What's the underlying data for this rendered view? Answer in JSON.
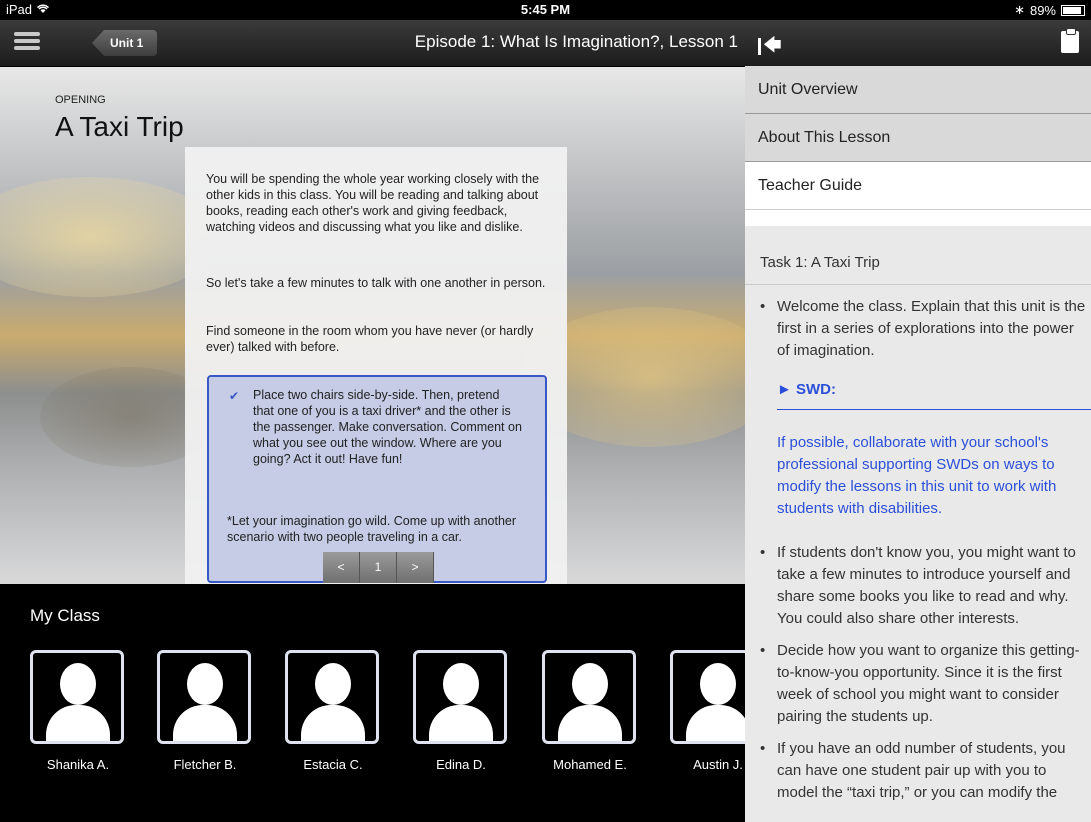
{
  "status_bar": {
    "device": "iPad",
    "time": "5:45 PM",
    "battery": "89%",
    "battery_level": 0.89
  },
  "nav": {
    "unit_button": "Unit 1",
    "title": "Episode 1: What Is Imagination?, Lesson 1"
  },
  "lesson": {
    "section": "OPENING",
    "title": "A Taxi Trip",
    "paragraphs": [
      "You will be spending the whole year working closely with the other kids in this class. You will be reading and talking about books, reading each other's work and giving feedback, watching videos and discussing what you like and dislike.",
      "So let's take a few minutes to talk with one another in person.",
      "Find someone in the room whom you have never (or hardly ever) talked with before."
    ],
    "activity": {
      "text": "Place two chairs side-by-side. Then, pretend that one of you is a taxi driver* and the other is the passenger. Make conversation. Comment on what you see out the window. Where are you going? Act it out! Have fun!",
      "note": "*Let your imagination go wild. Come up with another scenario with two people traveling in a car."
    },
    "pager": {
      "prev": "<",
      "page": "1",
      "next": ">"
    }
  },
  "my_class": {
    "title": "My Class",
    "students": [
      "Shanika A.",
      "Fletcher B.",
      "Estacia C.",
      "Edina D.",
      "Mohamed E.",
      "Austin J."
    ]
  },
  "panel": {
    "items": [
      "Unit Overview",
      "About This Lesson",
      "Teacher Guide"
    ],
    "task_title": "Task 1: A Taxi Trip",
    "bullets": [
      "Welcome the class. Explain that this unit is the first in a series of explorations into the power of imagination.",
      "If students don't know you, you might want to take a few minutes to introduce yourself and share some books you like to read and why. You could also share other interests.",
      "Decide how you want to organize this getting-to-know-you opportunity. Since it is the first week of school you might want to consider pairing the students up.",
      "If you have an odd number of students, you can have one student pair up with you to model the “taxi trip,” or you can modify the"
    ],
    "swd_label": "► SWD:",
    "swd_text": "If possible, collaborate with your school's professional supporting SWDs on ways to modify the lessons in this unit to work with students with disabilities."
  }
}
